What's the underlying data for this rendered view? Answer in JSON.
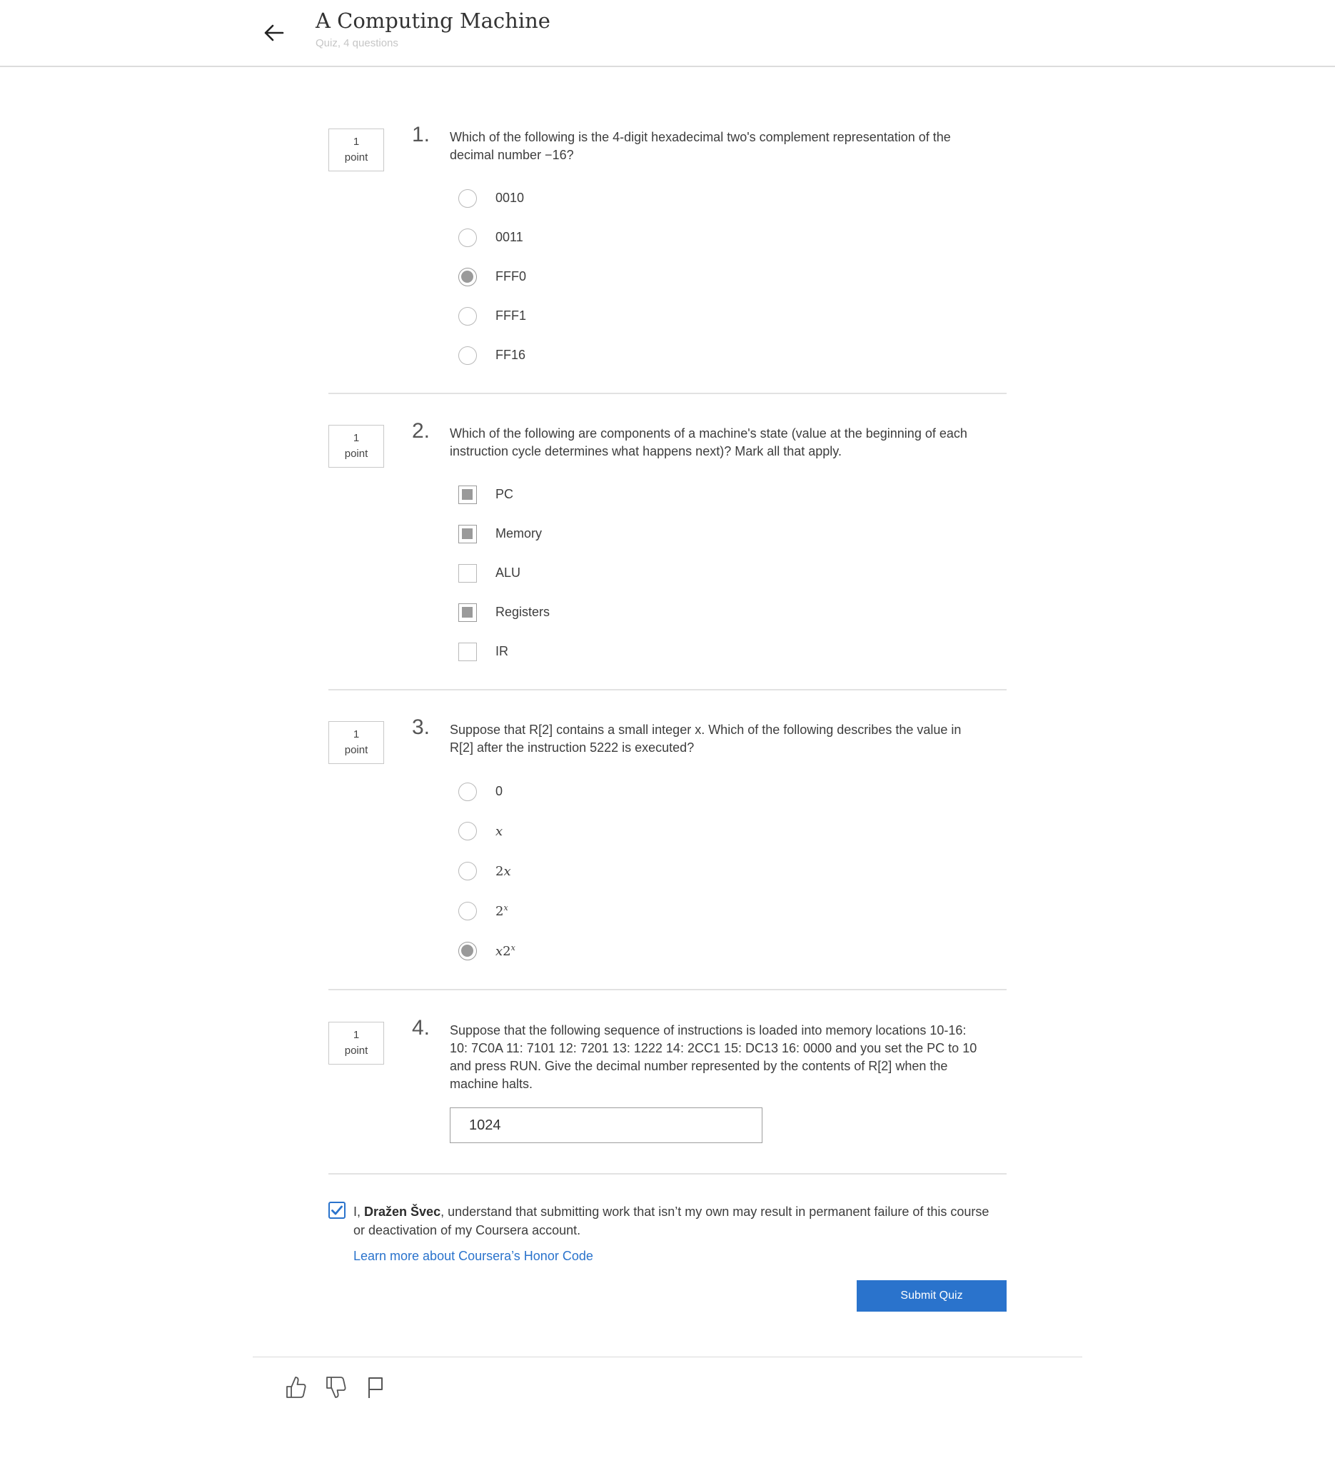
{
  "header": {
    "title": "A Computing Machine",
    "subtitle": "Quiz, 4 questions"
  },
  "questions": [
    {
      "number": "1.",
      "points_value": "1",
      "points_label": "point",
      "type": "radio",
      "text": "Which of the following is the 4-digit hexadecimal two's complement representation of the decimal number −16?",
      "options": [
        {
          "label": "0010",
          "selected": false
        },
        {
          "label": "0011",
          "selected": false
        },
        {
          "label": "FFF0",
          "selected": true
        },
        {
          "label": "FFF1",
          "selected": false
        },
        {
          "label": "FF16",
          "selected": false
        }
      ]
    },
    {
      "number": "2.",
      "points_value": "1",
      "points_label": "point",
      "type": "checkbox",
      "text": "Which of the following are components of a machine's state (value at the beginning of each instruction cycle determines what happens next)? Mark all that apply.",
      "options": [
        {
          "label": "PC",
          "selected": true
        },
        {
          "label": "Memory",
          "selected": true
        },
        {
          "label": "ALU",
          "selected": false
        },
        {
          "label": "Registers",
          "selected": true
        },
        {
          "label": "IR",
          "selected": false
        }
      ]
    },
    {
      "number": "3.",
      "points_value": "1",
      "points_label": "point",
      "type": "radio",
      "text": "Suppose that R[2] contains a small integer x. Which of the following describes the value in R[2] after the instruction 5222 is executed?",
      "options": [
        {
          "label": "0",
          "selected": false
        },
        {
          "label": "x",
          "selected": false
        },
        {
          "label": "2x",
          "selected": false
        },
        {
          "label": "2^x",
          "selected": false
        },
        {
          "label": "x2^x",
          "selected": true
        }
      ]
    },
    {
      "number": "4.",
      "points_value": "1",
      "points_label": "point",
      "type": "text",
      "text": "Suppose that the following sequence of instructions is loaded into memory locations 10-16: 10: 7C0A 11: 7101 12: 7201 13: 1222 14: 2CC1 15: DC13 16: 0000 and you set the PC to 10 and press RUN. Give the decimal number represented by the contents of R[2] when the machine halts.",
      "answer": "1024"
    }
  ],
  "honor": {
    "prefix": "I, ",
    "name": "Dražen Švec",
    "suffix": ", understand that submitting work that isn’t my own may result in permanent failure of this course or deactivation of my Coursera account.",
    "checked": true,
    "link_text": "Learn more about Coursera’s Honor Code"
  },
  "submit_label": "Submit Quiz",
  "footer_icons": [
    "thumbs-up-icon",
    "thumbs-down-icon",
    "flag-icon"
  ],
  "colors": {
    "accent": "#2a73cc",
    "selected_fill": "#9a9a9a",
    "divider": "#e2e2e2"
  }
}
